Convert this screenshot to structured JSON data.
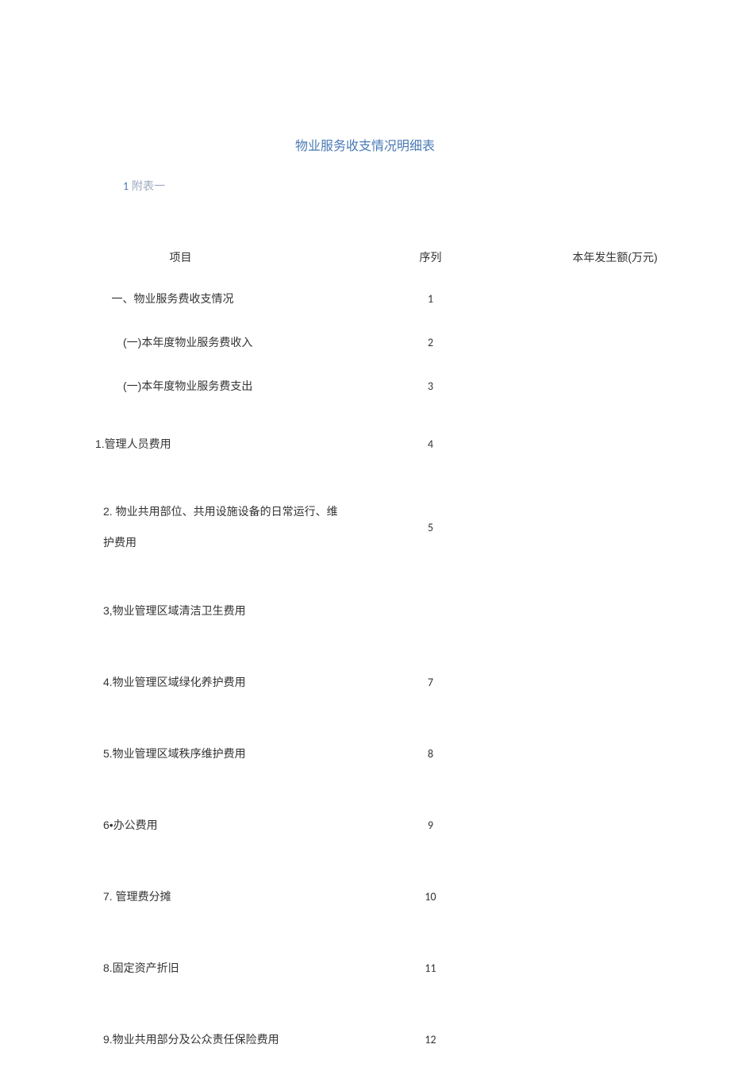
{
  "title": "物业服务收支情况明细表",
  "subtitle_num": "1",
  "subtitle_label": " 附表一",
  "headers": {
    "item": "项目",
    "seq": "序列",
    "amount": "本年发生额(万元)"
  },
  "rows": [
    {
      "item": "一、物业服务费收支情况",
      "seq": "1",
      "amount": ""
    },
    {
      "item": "(一)本年度物业服务费收入",
      "seq": "2",
      "amount": ""
    },
    {
      "item": "(一)本年度物业服务费支出",
      "seq": "3",
      "amount": ""
    },
    {
      "item": "1.管理人员费用",
      "seq": "4",
      "amount": ""
    },
    {
      "item": "2. 物业共用部位、共用设施设备的日常运行、维护费用",
      "seq": "5",
      "amount": ""
    },
    {
      "item": "3,物业管理区域清洁卫生费用",
      "seq": "",
      "amount": ""
    },
    {
      "item": "4.物业管理区域绿化养护费用",
      "seq": "7",
      "amount": ""
    },
    {
      "item": "5.物业管理区域秩序维护费用",
      "seq": "8",
      "amount": ""
    },
    {
      "item": "6•办公费用",
      "seq": "9",
      "amount": ""
    },
    {
      "item": "7. 管理费分摊",
      "seq": "10",
      "amount": ""
    },
    {
      "item": "8.固定资产折旧",
      "seq": "11",
      "amount": ""
    },
    {
      "item": "9.物业共用部分及公众责任保险费用",
      "seq": "12",
      "amount": ""
    }
  ]
}
